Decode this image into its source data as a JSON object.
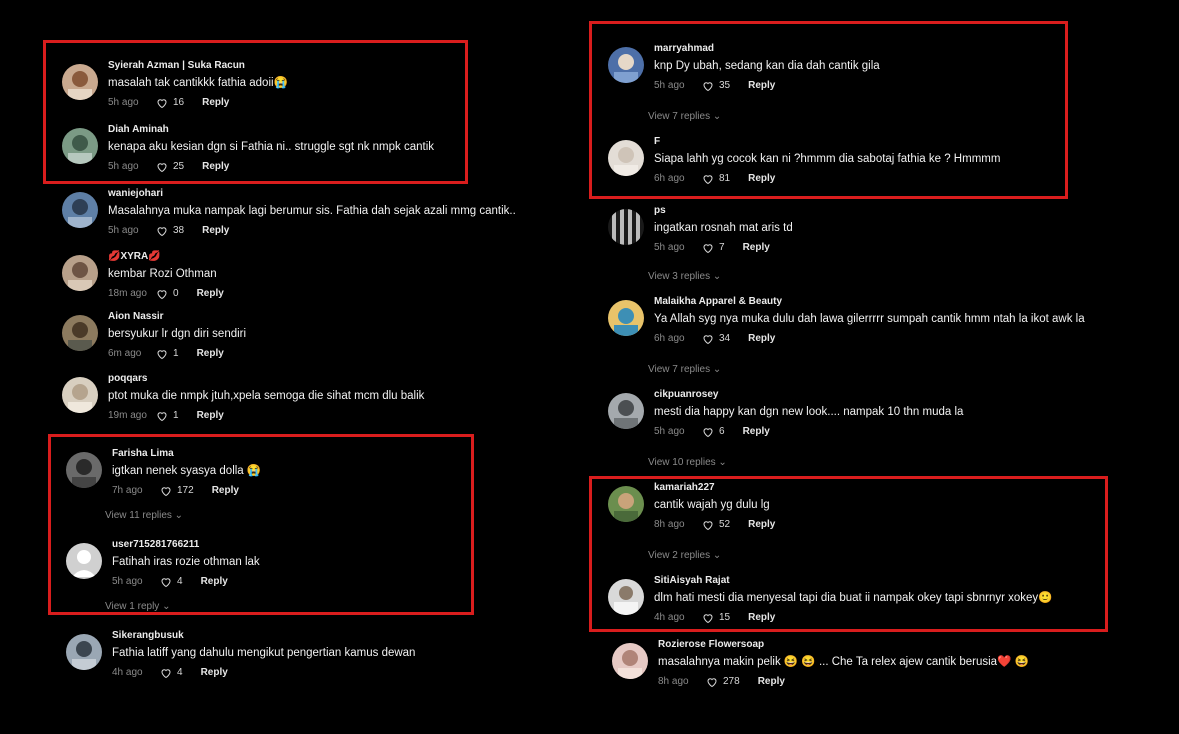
{
  "colors": {
    "highlight": "#d91d1d",
    "background": "#000000"
  },
  "reply_label": "Reply",
  "left_comments": [
    {
      "user": "Syierah Azman | Suka Racun",
      "text": "masalah tak cantikkk fathia adoii😭",
      "time": "5h ago",
      "likes": "16"
    },
    {
      "user": "Diah Aminah",
      "text": "kenapa aku kesian dgn si Fathia ni.. struggle sgt nk nmpk cantik",
      "time": "5h ago",
      "likes": "25"
    },
    {
      "user": "waniejohari",
      "text": "Masalahnya muka nampak lagi berumur sis. Fathia dah sejak azali mmg cantik..",
      "time": "5h ago",
      "likes": "38"
    },
    {
      "user": "💋XYRA💋",
      "text": "kembar Rozi Othman",
      "time": "18m ago",
      "likes": "0"
    },
    {
      "user": "Aion Nassir",
      "text": "bersyukur lr dgn diri sendiri",
      "time": "6m ago",
      "likes": "1"
    },
    {
      "user": "poqqars",
      "text": "ptot muka die nmpk jtuh,xpela semoga die sihat mcm dlu balik",
      "time": "19m ago",
      "likes": "1"
    },
    {
      "user": "Farisha Lima",
      "text": "igtkan nenek syasya dolla 😭",
      "time": "7h ago",
      "likes": "172",
      "replies": "View 11 replies"
    },
    {
      "user": "user715281766211",
      "text": "Fatihah iras rozie othman lak",
      "time": "5h ago",
      "likes": "4",
      "replies": "View 1 reply"
    },
    {
      "user": "Sikerangbusuk",
      "text": "Fathia latiff yang dahulu mengikut pengertian kamus dewan",
      "time": "4h ago",
      "likes": "4"
    }
  ],
  "right_comments": [
    {
      "user": "marryahmad",
      "text": "knp Dy ubah, sedang kan dia dah cantik gila",
      "time": "5h ago",
      "likes": "35",
      "replies": "View 7 replies"
    },
    {
      "user": "F",
      "text": "Siapa lahh yg cocok kan ni ?hmmm dia sabotaj fathia ke ? Hmmmm",
      "time": "6h ago",
      "likes": "81"
    },
    {
      "user": "ps",
      "text": "ingatkan rosnah mat aris td",
      "time": "5h ago",
      "likes": "7",
      "replies": "View 3 replies"
    },
    {
      "user": "Malaikha Apparel & Beauty",
      "text": "Ya Allah syg nya muka dulu dah lawa gilerrrrr sumpah cantik hmm ntah la ikot awk la",
      "time": "6h ago",
      "likes": "34",
      "replies": "View 7 replies"
    },
    {
      "user": "cikpuanrosey",
      "text": "mesti dia happy kan dgn new look.... nampak 10 thn muda la",
      "time": "5h ago",
      "likes": "6",
      "replies": "View 10 replies"
    },
    {
      "user": "kamariah227",
      "text": "cantik wajah yg dulu lg",
      "time": "8h ago",
      "likes": "52",
      "replies": "View 2 replies"
    },
    {
      "user": "SitiAisyah Rajat",
      "text": "dlm hati mesti dia menyesal tapi dia buat ii nampak okey tapi sbnrnyr xokey🙂",
      "time": "4h ago",
      "likes": "15"
    },
    {
      "user": "Rozierose Flowersoap",
      "text": "masalahnya makin pelik 😆 😆 ... Che Ta relex ajew cantik berusia❤️ 😆",
      "time": "8h ago",
      "likes": "278"
    }
  ]
}
